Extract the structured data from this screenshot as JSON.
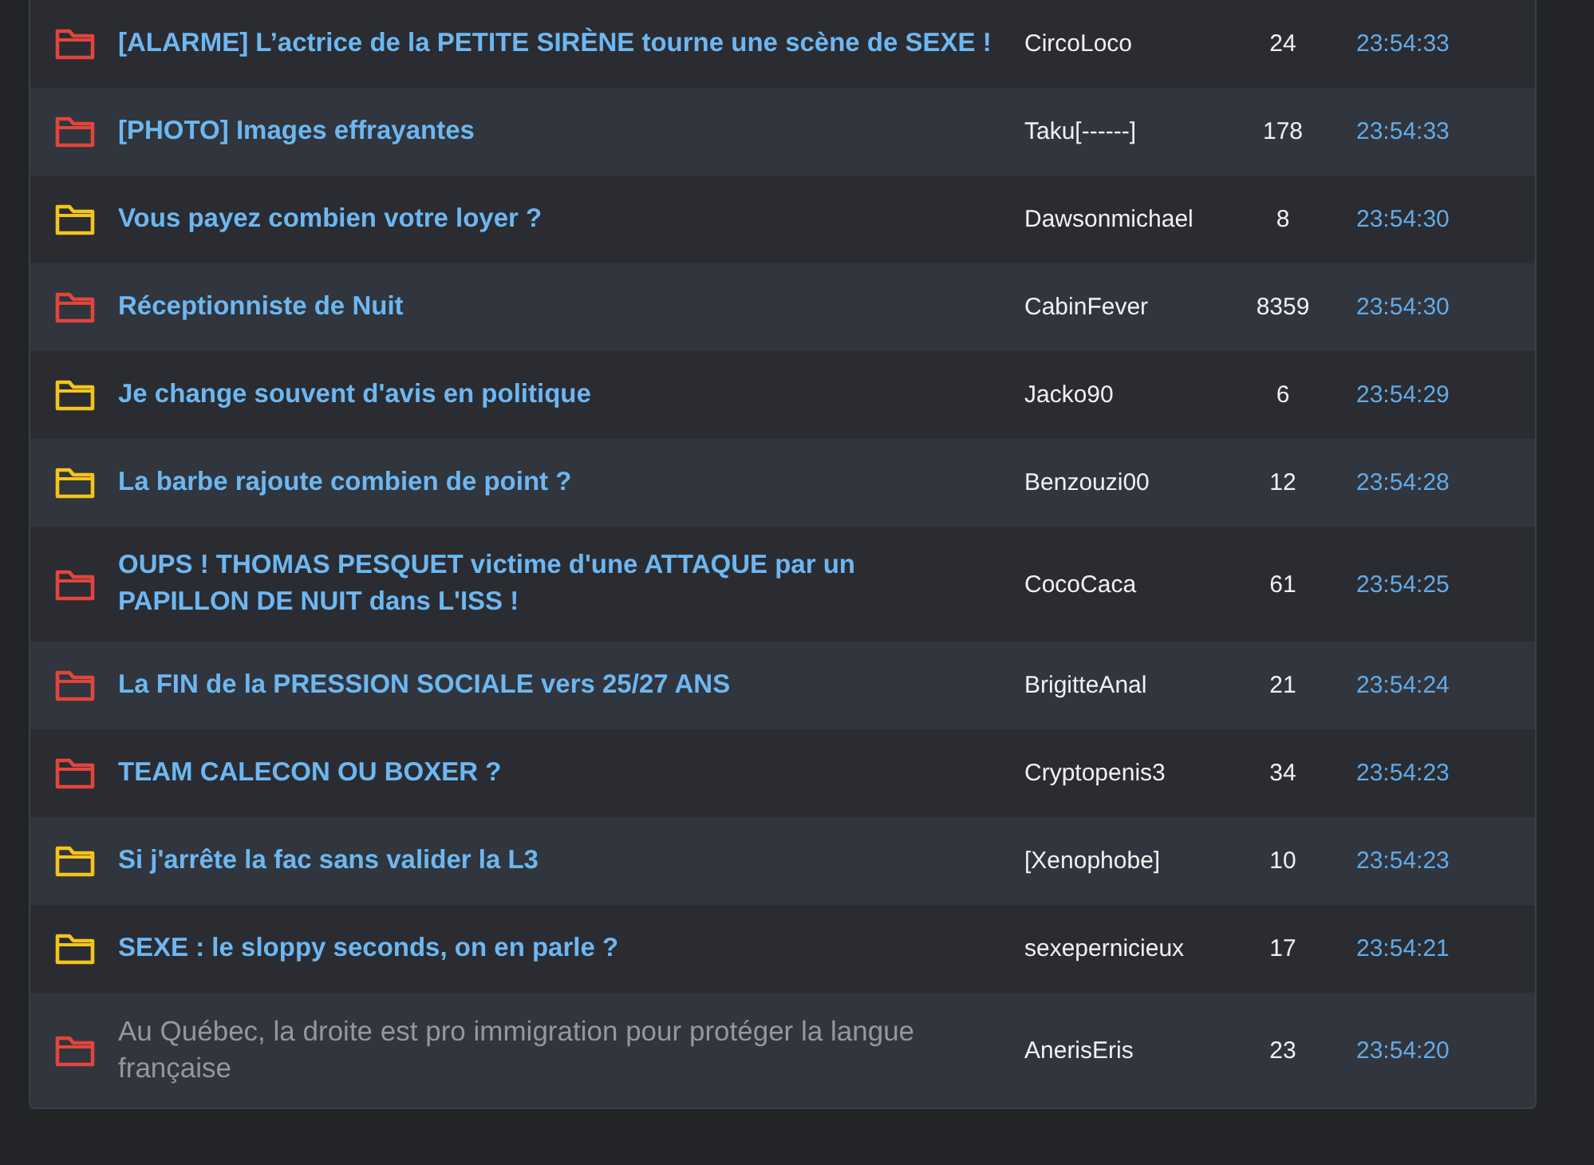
{
  "topics": [
    {
      "color": "#e2453c",
      "title": "[ALARME] L’actrice de la PETITE SIRÈNE tourne une scène de SEXE !",
      "visited": false,
      "author": "CircoLoco",
      "replies": "24",
      "time": "23:54:33"
    },
    {
      "color": "#e2453c",
      "title": "[PHOTO] Images effrayantes",
      "visited": false,
      "author": "Taku[------]",
      "replies": "178",
      "time": "23:54:33"
    },
    {
      "color": "#f4c41b",
      "title": "Vous payez combien votre loyer ?",
      "visited": false,
      "author": "Dawsonmichael",
      "replies": "8",
      "time": "23:54:30"
    },
    {
      "color": "#e2453c",
      "title": "Réceptionniste de Nuit",
      "visited": false,
      "author": "CabinFever",
      "replies": "8359",
      "time": "23:54:30"
    },
    {
      "color": "#f4c41b",
      "title": "Je change souvent d'avis en politique",
      "visited": false,
      "author": "Jacko90",
      "replies": "6",
      "time": "23:54:29"
    },
    {
      "color": "#f4c41b",
      "title": "La barbe rajoute combien de point ?",
      "visited": false,
      "author": "Benzouzi00",
      "replies": "12",
      "time": "23:54:28"
    },
    {
      "color": "#e2453c",
      "title": "OUPS ! THOMAS PESQUET victime d'une ATTAQUE par un PAPILLON DE NUIT dans L'ISS !",
      "visited": false,
      "author": "CocoCaca",
      "replies": "61",
      "time": "23:54:25"
    },
    {
      "color": "#e2453c",
      "title": "La FIN de la PRESSION SOCIALE vers 25/27 ANS",
      "visited": false,
      "author": "BrigitteAnal",
      "replies": "21",
      "time": "23:54:24"
    },
    {
      "color": "#e2453c",
      "title": "TEAM CALECON OU BOXER ?",
      "visited": false,
      "author": "Cryptopenis3",
      "replies": "34",
      "time": "23:54:23"
    },
    {
      "color": "#f4c41b",
      "title": "Si j'arrête la fac sans valider la L3",
      "visited": false,
      "author": "[Xenophobe]",
      "replies": "10",
      "time": "23:54:23"
    },
    {
      "color": "#f4c41b",
      "title": "SEXE : le sloppy seconds, on en parle ?",
      "visited": false,
      "author": "sexepernicieux",
      "replies": "17",
      "time": "23:54:21"
    },
    {
      "color": "#e2453c",
      "title": "Au Québec, la droite est pro immigration pour protéger la langue française",
      "visited": true,
      "author": "AnerisEris",
      "replies": "23",
      "time": "23:54:20"
    }
  ]
}
